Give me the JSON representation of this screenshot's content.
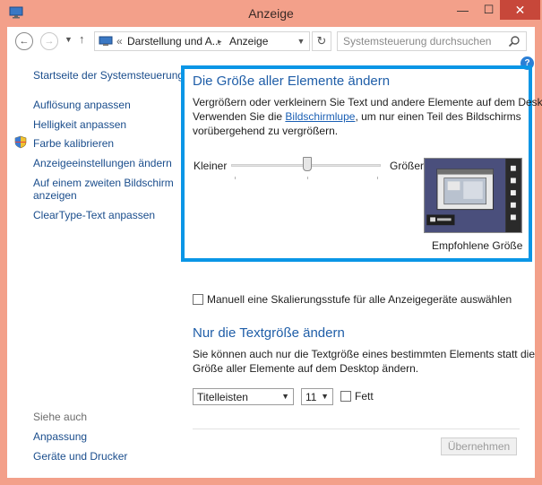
{
  "window": {
    "title": "Anzeige",
    "controls": {
      "minimize": "—",
      "maximize": "☐",
      "close": "✕"
    }
  },
  "addressbar": {
    "overflow": "«",
    "crumbs": [
      "Darstellung und A...",
      "Anzeige"
    ],
    "separator": "▸",
    "search_placeholder": "Systemsteuerung durchsuchen"
  },
  "sidebar": {
    "home": "Startseite der Systemsteuerung",
    "links": [
      "Auflösung anpassen",
      "Helligkeit anpassen",
      "Farbe kalibrieren",
      "Anzeigeeinstellungen ändern",
      "Auf einem zweiten Bildschirm",
      "anzeigen",
      "ClearType-Text anpassen"
    ],
    "see_also": "Siehe auch",
    "see_also_links": [
      "Anpassung",
      "Geräte und Drucker"
    ]
  },
  "main": {
    "heading": "Die Größe aller Elemente ändern",
    "desc_line1": "Vergrößern oder verkleinern Sie Text und andere Elemente auf dem Desktop.",
    "desc_line2_pre": "Verwenden Sie die ",
    "desc_link": "Bildschirmlupe",
    "desc_line2_post": ", um nur einen Teil des Bildschirms",
    "desc_line3": "vorübergehend zu vergrößern.",
    "slider": {
      "min_label": "Kleiner",
      "max_label": "Größer",
      "value_fraction": 0.5
    },
    "preview_caption": "Empfohlene Größe",
    "manual_checkbox_label": "Manuell eine Skalierungsstufe für alle Anzeigegeräte auswählen",
    "manual_checked": false,
    "text_heading": "Nur die Textgröße ändern",
    "text_desc1": "Sie können auch nur die Textgröße eines bestimmten Elements statt die",
    "text_desc2": "Größe aller Elemente auf dem Desktop ändern.",
    "element_select": "Titelleisten",
    "size_select": "11",
    "bold_label": "Fett",
    "bold_checked": false,
    "apply_button": "Übernehmen"
  },
  "colors": {
    "titlebar": "#f3a08a",
    "highlight_border": "#0a96e6",
    "heading": "#1f5ea8",
    "link": "#1a4d8c"
  }
}
